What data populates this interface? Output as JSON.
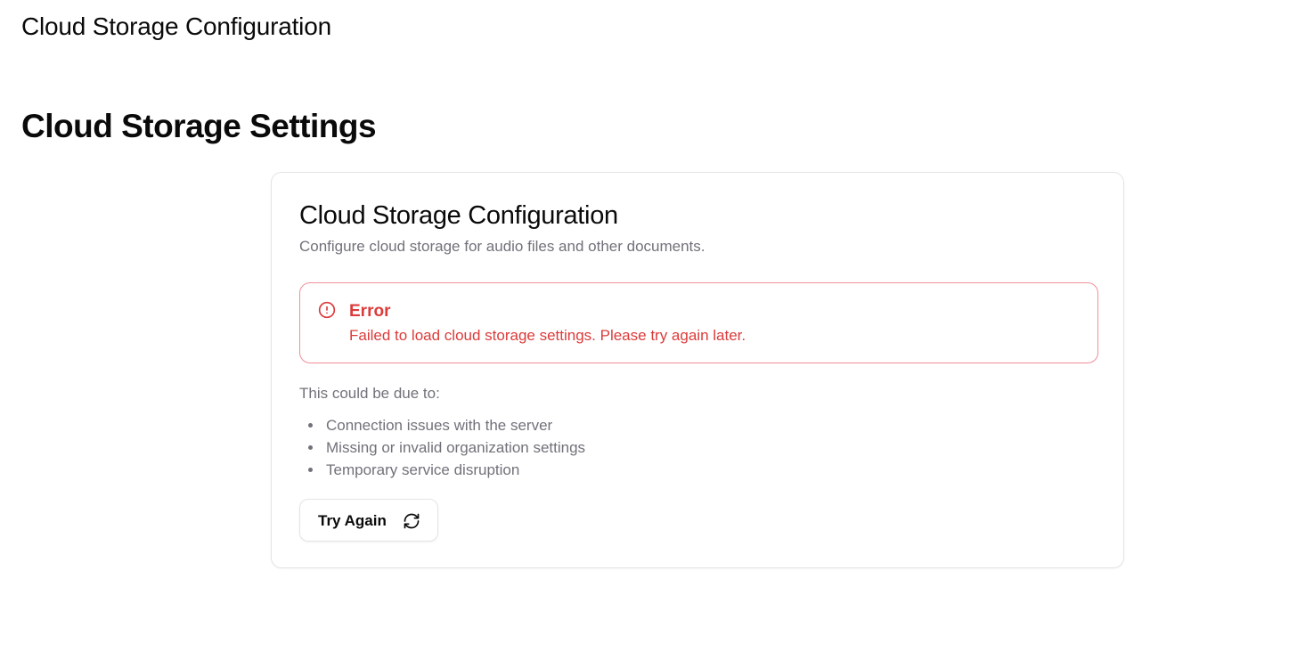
{
  "header": {
    "title": "Cloud Storage Configuration"
  },
  "page": {
    "heading": "Cloud Storage Settings"
  },
  "card": {
    "title": "Cloud Storage Configuration",
    "description": "Configure cloud storage for audio files and other documents.",
    "alert": {
      "icon": "alert-circle-icon",
      "title": "Error",
      "message": "Failed to load cloud storage settings. Please try again later.",
      "color": "#dc3b3b",
      "border_color": "#ef8f99"
    },
    "causes": {
      "intro": "This could be due to:",
      "items": [
        "Connection issues with the server",
        "Missing or invalid organization settings",
        "Temporary service disruption"
      ]
    },
    "retry_button": {
      "label": "Try Again",
      "icon": "refresh-icon"
    }
  }
}
